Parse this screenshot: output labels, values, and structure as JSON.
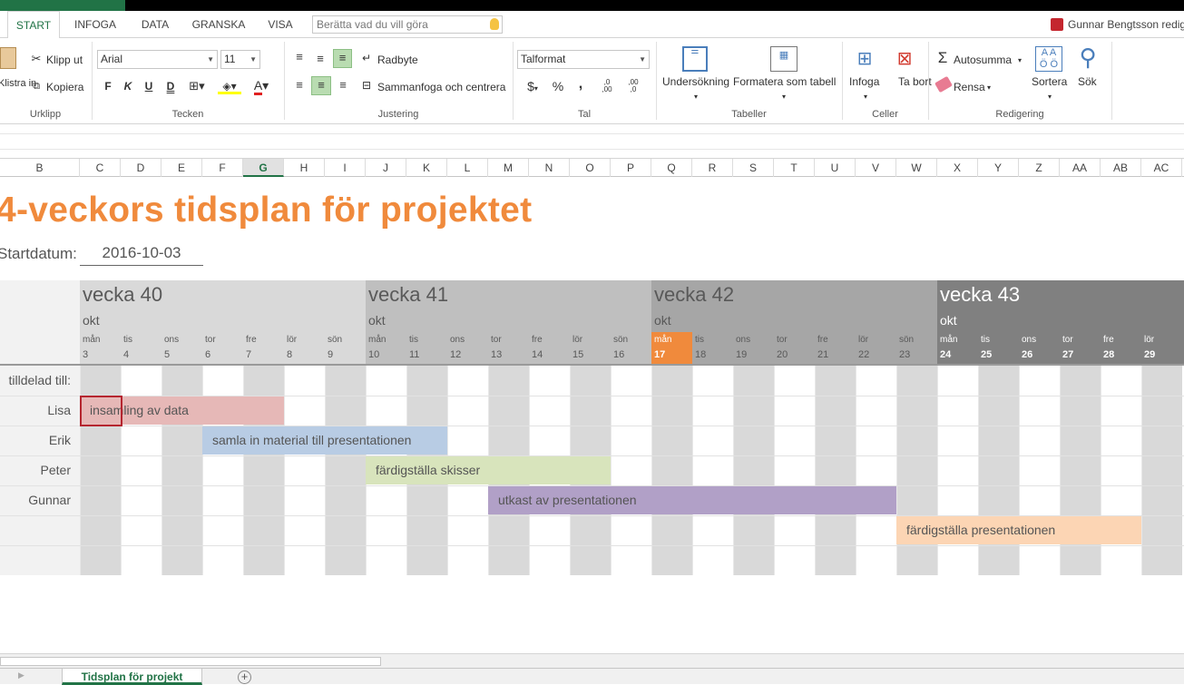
{
  "ribbon_tabs": [
    "START",
    "INFOGA",
    "DATA",
    "GRANSKA",
    "VISA"
  ],
  "tell_me_placeholder": "Berätta vad du vill göra",
  "user_name": "Gunnar Bengtsson redigerar",
  "clipboard": {
    "paste": "Klistra in",
    "cut": "Klipp ut",
    "copy": "Kopiera",
    "group": "Urklipp"
  },
  "font": {
    "name": "Arial",
    "size": "11",
    "bold": "F",
    "italic": "K",
    "underline": "U",
    "strike": "D",
    "color_letter": "A",
    "group": "Tecken"
  },
  "alignment": {
    "wrap": "Radbyte",
    "merge": "Sammanfoga och centrera",
    "group": "Justering"
  },
  "number": {
    "format": "Talformat",
    "currency": "$",
    "percent": "%",
    "comma": ",",
    "inc": ",0\n,00",
    "dec": ",00\n,0",
    "group": "Tal"
  },
  "tables": {
    "research": "Undersökning",
    "format_table": "Formatera som tabell",
    "group": "Tabeller"
  },
  "cells": {
    "insert": "Infoga",
    "delete": "Ta bort",
    "group": "Celler"
  },
  "editing": {
    "autosum": "Autosumma",
    "clear": "Rensa",
    "sort": "Sortera",
    "find": "Sök",
    "group": "Redigering"
  },
  "columns": [
    "B",
    "C",
    "D",
    "E",
    "F",
    "G",
    "H",
    "I",
    "J",
    "K",
    "L",
    "M",
    "N",
    "O",
    "P",
    "Q",
    "R",
    "S",
    "T",
    "U",
    "V",
    "W",
    "X",
    "Y",
    "Z",
    "AA",
    "AB",
    "AC"
  ],
  "selected_column": "G",
  "sheet": {
    "title": "4-veckors tidsplan för projektet",
    "start_label": "Startdatum:",
    "start_value": "2016-10-03",
    "assigned_label": "tilldelad till:",
    "weeks": [
      {
        "label": "vecka 40",
        "month": "okt",
        "days": [
          [
            "mån",
            "3"
          ],
          [
            "tis",
            "4"
          ],
          [
            "ons",
            "5"
          ],
          [
            "tor",
            "6"
          ],
          [
            "fre",
            "7"
          ],
          [
            "lör",
            "8"
          ],
          [
            "sön",
            "9"
          ]
        ]
      },
      {
        "label": "vecka 41",
        "month": "okt",
        "days": [
          [
            "mån",
            "10"
          ],
          [
            "tis",
            "11"
          ],
          [
            "ons",
            "12"
          ],
          [
            "tor",
            "13"
          ],
          [
            "fre",
            "14"
          ],
          [
            "lör",
            "15"
          ],
          [
            "sön",
            "16"
          ]
        ]
      },
      {
        "label": "vecka 42",
        "month": "okt",
        "days": [
          [
            "mån",
            "17"
          ],
          [
            "tis",
            "18"
          ],
          [
            "ons",
            "19"
          ],
          [
            "tor",
            "20"
          ],
          [
            "fre",
            "21"
          ],
          [
            "lör",
            "22"
          ],
          [
            "sön",
            "23"
          ]
        ]
      },
      {
        "label": "vecka 43",
        "month": "okt",
        "days": [
          [
            "mån",
            "24"
          ],
          [
            "tis",
            "25"
          ],
          [
            "ons",
            "26"
          ],
          [
            "tor",
            "27"
          ],
          [
            "fre",
            "28"
          ],
          [
            "lör",
            "29"
          ]
        ]
      }
    ],
    "today": "17",
    "people": [
      "Lisa",
      "Erik",
      "Peter",
      "Gunnar",
      "",
      ""
    ],
    "tasks": [
      {
        "label": "insamling av data",
        "row": 1,
        "start": "3",
        "end": "7",
        "color": "#e6b8b7"
      },
      {
        "label": "samla in material till presentationen",
        "row": 2,
        "start": "6",
        "end": "11",
        "color": "#b8cce4"
      },
      {
        "label": "färdigställa skisser",
        "row": 3,
        "start": "10",
        "end": "15",
        "color": "#d8e4bc"
      },
      {
        "label": "utkast av presentationen",
        "row": 4,
        "start": "13",
        "end": "22",
        "color": "#b1a0c7"
      },
      {
        "label": "färdigställa presentationen",
        "row": 5,
        "start": "23",
        "end": "28",
        "color": "#fcd5b4"
      }
    ]
  },
  "sheet_tab": "Tidsplan för projekt"
}
